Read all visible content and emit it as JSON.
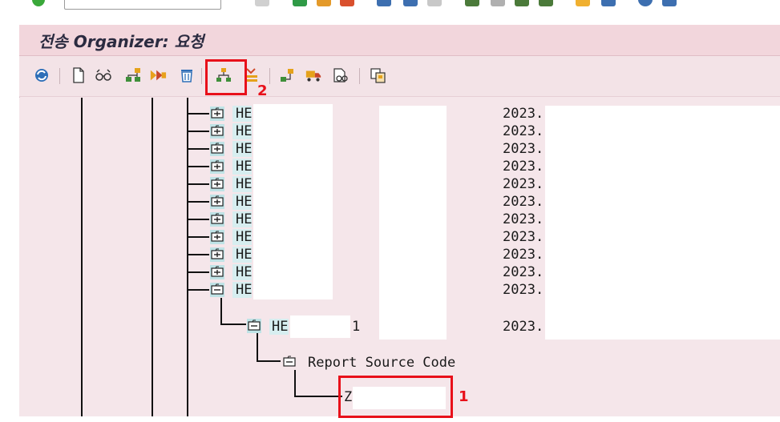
{
  "title": "전송 Organizer: 요청",
  "tree_rows": [
    {
      "prefix": "HE",
      "date": "2023."
    },
    {
      "prefix": "HE",
      "date": "2023."
    },
    {
      "prefix": "HE",
      "date": "2023."
    },
    {
      "prefix": "HE",
      "date": "2023."
    },
    {
      "prefix": "HE",
      "date": "2023."
    },
    {
      "prefix": "HE",
      "date": "2023."
    },
    {
      "prefix": "HE",
      "date": "2023."
    },
    {
      "prefix": "HE",
      "date": "2023."
    },
    {
      "prefix": "HE",
      "date": "2023."
    },
    {
      "prefix": "HE",
      "date": "2023."
    },
    {
      "prefix": "HE",
      "date": "2023."
    }
  ],
  "subtask": {
    "prefix": "HE",
    "suffix": "1",
    "date": "2023."
  },
  "object_folder": "Report Source Code",
  "object_item": "Z",
  "annotations": {
    "one": "1",
    "two": "2"
  },
  "toolbar_icons": [
    "refresh-icon",
    "new-document-icon",
    "glasses-icon",
    "hierarchy-icon",
    "transport-release-icon",
    "delete-icon",
    "include-objects-icon",
    "merge-down-icon",
    "object-list-icon",
    "truck-icon",
    "display-icon",
    "copy-icon"
  ]
}
